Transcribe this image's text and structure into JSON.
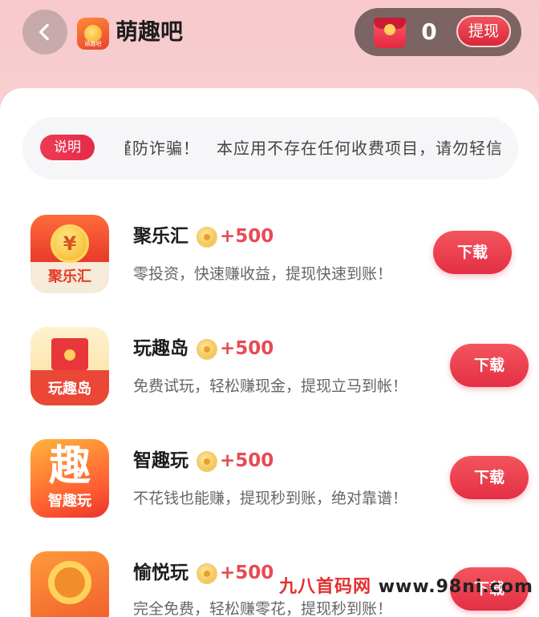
{
  "header": {
    "title": "萌趣吧",
    "logo_label": "萌趣吧",
    "balance": "0",
    "withdraw_label": "提现"
  },
  "notice": {
    "badge": "说明",
    "text": "谨防诈骗！　本应用不存在任何收费项目，请勿轻信"
  },
  "apps": [
    {
      "name": "聚乐汇",
      "reward": "+500",
      "desc": "零投资，快速赚收益，提现快速到账！",
      "button": "下载",
      "icon_glyph": "¥",
      "icon_caption": "聚乐汇"
    },
    {
      "name": "玩趣岛",
      "reward": "+500",
      "desc": "免费试玩，轻松赚现金，提现立马到帐！",
      "button": "下载",
      "icon_caption": "玩趣岛"
    },
    {
      "name": "智趣玩",
      "reward": "+500",
      "desc": "不花钱也能赚，提现秒到账，绝对靠谱！",
      "button": "下载",
      "icon_glyph": "趣",
      "icon_caption": "智趣玩"
    },
    {
      "name": "愉悦玩",
      "reward": "+500",
      "desc": "完全免费，轻松赚零花，提现秒到账！",
      "button": "下载"
    }
  ],
  "watermark": {
    "site_name": "九八首码网",
    "url": "www.98ni.com"
  },
  "colors": {
    "accent": "#e42f44",
    "reward": "#e84a55",
    "background_top": "#f7c9cc"
  }
}
